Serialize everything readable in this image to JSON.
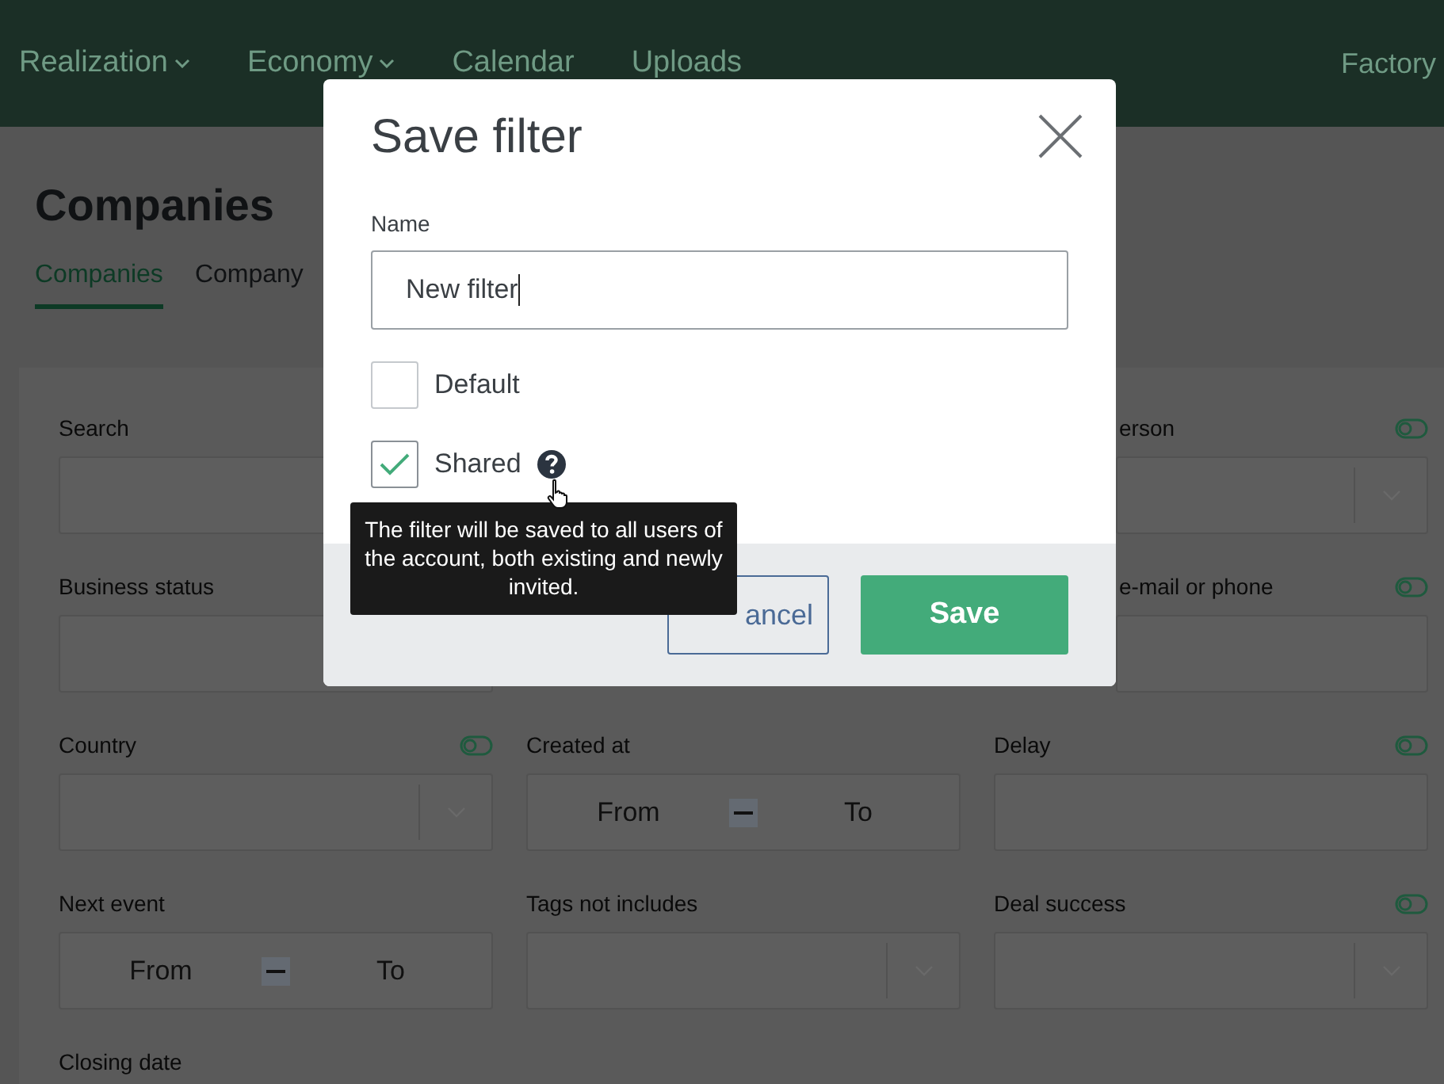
{
  "nav": {
    "items": [
      {
        "label": "Realization",
        "dropdown": true
      },
      {
        "label": "Economy",
        "dropdown": true
      },
      {
        "label": "Calendar",
        "dropdown": false
      },
      {
        "label": "Uploads",
        "dropdown": false
      }
    ],
    "right_item": "Factory"
  },
  "page": {
    "title": "Companies",
    "tabs": [
      {
        "label": "Companies",
        "selected": true
      },
      {
        "label": "Company",
        "selected": false
      }
    ]
  },
  "filter_rows": [
    {
      "left": {
        "label": "Search",
        "kind": "input"
      },
      "right": {
        "label": "erson",
        "kind": "select",
        "toggle": {
          "on": false
        }
      }
    },
    {
      "left": {
        "label": "Business status",
        "kind": "input"
      },
      "right": {
        "label": "e-mail or phone",
        "kind": "input",
        "toggle": {
          "on": false
        }
      }
    },
    {
      "left": {
        "label": "Country",
        "kind": "select",
        "toggle": {
          "on": false
        }
      },
      "middle": {
        "label": "Created at",
        "kind": "range",
        "from": "From",
        "to": "To"
      },
      "right": {
        "label": "Delay",
        "kind": "input",
        "toggle": {
          "on": false
        }
      }
    },
    {
      "left": {
        "label": "Next event",
        "kind": "range",
        "from": "From",
        "to": "To"
      },
      "middle": {
        "label": "Tags not includes",
        "kind": "select"
      },
      "right": {
        "label": "Deal success",
        "kind": "select",
        "toggle": {
          "on": false
        }
      }
    },
    {
      "left": {
        "label": "Closing date",
        "kind": "label"
      }
    }
  ],
  "dialog": {
    "title": "Save filter",
    "name_label": "Name",
    "name_value": "New filter",
    "options": [
      {
        "label": "Default",
        "checked": false
      },
      {
        "label": "Shared",
        "checked": true,
        "help_tooltip": "The filter will be saved to all users of the account, both existing and newly invited."
      }
    ],
    "buttons": [
      {
        "label": "ancel",
        "kind": "secondary"
      },
      {
        "label": "Save",
        "kind": "primary"
      }
    ]
  }
}
